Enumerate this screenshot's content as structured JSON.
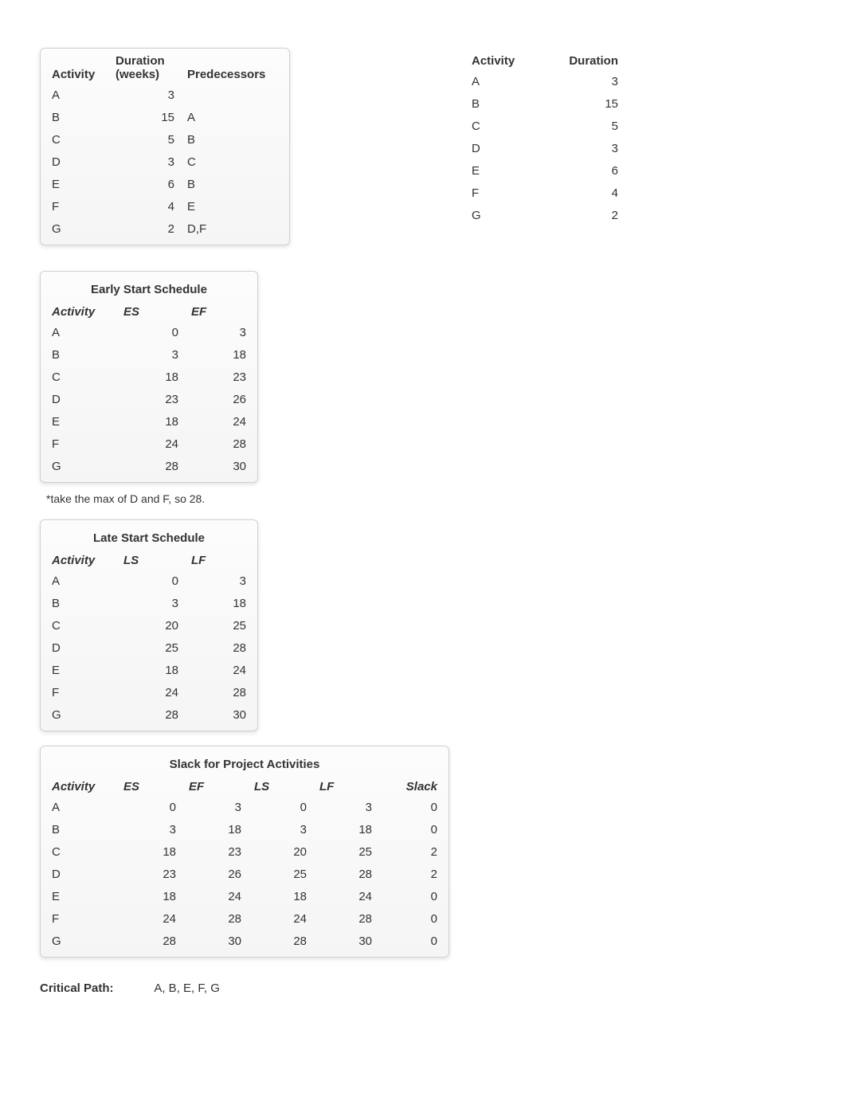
{
  "headers": {
    "activity": "Activity",
    "duration_weeks_l1": "Duration",
    "duration_weeks_l2": "(weeks)",
    "predecessors": "Predecessors",
    "duration": "Duration",
    "es": "ES",
    "ef": "EF",
    "ls": "LS",
    "lf": "LF",
    "slack": "Slack"
  },
  "titles": {
    "early_start": "Early Start Schedule",
    "late_start": "Late Start Schedule",
    "slack": "Slack for Project Activities"
  },
  "input_table": [
    {
      "activity": "A",
      "duration": "3",
      "predecessors": ""
    },
    {
      "activity": "B",
      "duration": "15",
      "predecessors": "A"
    },
    {
      "activity": "C",
      "duration": "5",
      "predecessors": "B"
    },
    {
      "activity": "D",
      "duration": "3",
      "predecessors": "C"
    },
    {
      "activity": "E",
      "duration": "6",
      "predecessors": "B"
    },
    {
      "activity": "F",
      "duration": "4",
      "predecessors": "E"
    },
    {
      "activity": "G",
      "duration": "2",
      "predecessors": "D,F"
    }
  ],
  "duration_table": [
    {
      "activity": "A",
      "duration": "3"
    },
    {
      "activity": "B",
      "duration": "15"
    },
    {
      "activity": "C",
      "duration": "5"
    },
    {
      "activity": "D",
      "duration": "3"
    },
    {
      "activity": "E",
      "duration": "6"
    },
    {
      "activity": "F",
      "duration": "4"
    },
    {
      "activity": "G",
      "duration": "2"
    }
  ],
  "early_start": [
    {
      "activity": "A",
      "es": "0",
      "ef": "3"
    },
    {
      "activity": "B",
      "es": "3",
      "ef": "18"
    },
    {
      "activity": "C",
      "es": "18",
      "ef": "23"
    },
    {
      "activity": "D",
      "es": "23",
      "ef": "26"
    },
    {
      "activity": "E",
      "es": "18",
      "ef": "24"
    },
    {
      "activity": "F",
      "es": "24",
      "ef": "28"
    },
    {
      "activity": "G",
      "es": "28",
      "ef": "30"
    }
  ],
  "early_note": "*take the max of D and F, so 28.",
  "late_start": [
    {
      "activity": "A",
      "ls": "0",
      "lf": "3"
    },
    {
      "activity": "B",
      "ls": "3",
      "lf": "18"
    },
    {
      "activity": "C",
      "ls": "20",
      "lf": "25"
    },
    {
      "activity": "D",
      "ls": "25",
      "lf": "28"
    },
    {
      "activity": "E",
      "ls": "18",
      "lf": "24"
    },
    {
      "activity": "F",
      "ls": "24",
      "lf": "28"
    },
    {
      "activity": "G",
      "ls": "28",
      "lf": "30"
    }
  ],
  "slack_table": [
    {
      "activity": "A",
      "es": "0",
      "ef": "3",
      "ls": "0",
      "lf": "3",
      "slack": "0"
    },
    {
      "activity": "B",
      "es": "3",
      "ef": "18",
      "ls": "3",
      "lf": "18",
      "slack": "0"
    },
    {
      "activity": "C",
      "es": "18",
      "ef": "23",
      "ls": "20",
      "lf": "25",
      "slack": "2"
    },
    {
      "activity": "D",
      "es": "23",
      "ef": "26",
      "ls": "25",
      "lf": "28",
      "slack": "2"
    },
    {
      "activity": "E",
      "es": "18",
      "ef": "24",
      "ls": "18",
      "lf": "24",
      "slack": "0"
    },
    {
      "activity": "F",
      "es": "24",
      "ef": "28",
      "ls": "24",
      "lf": "28",
      "slack": "0"
    },
    {
      "activity": "G",
      "es": "28",
      "ef": "30",
      "ls": "28",
      "lf": "30",
      "slack": "0"
    }
  ],
  "critical_path_label": "Critical Path:",
  "critical_path_value": "A, B, E, F, G"
}
